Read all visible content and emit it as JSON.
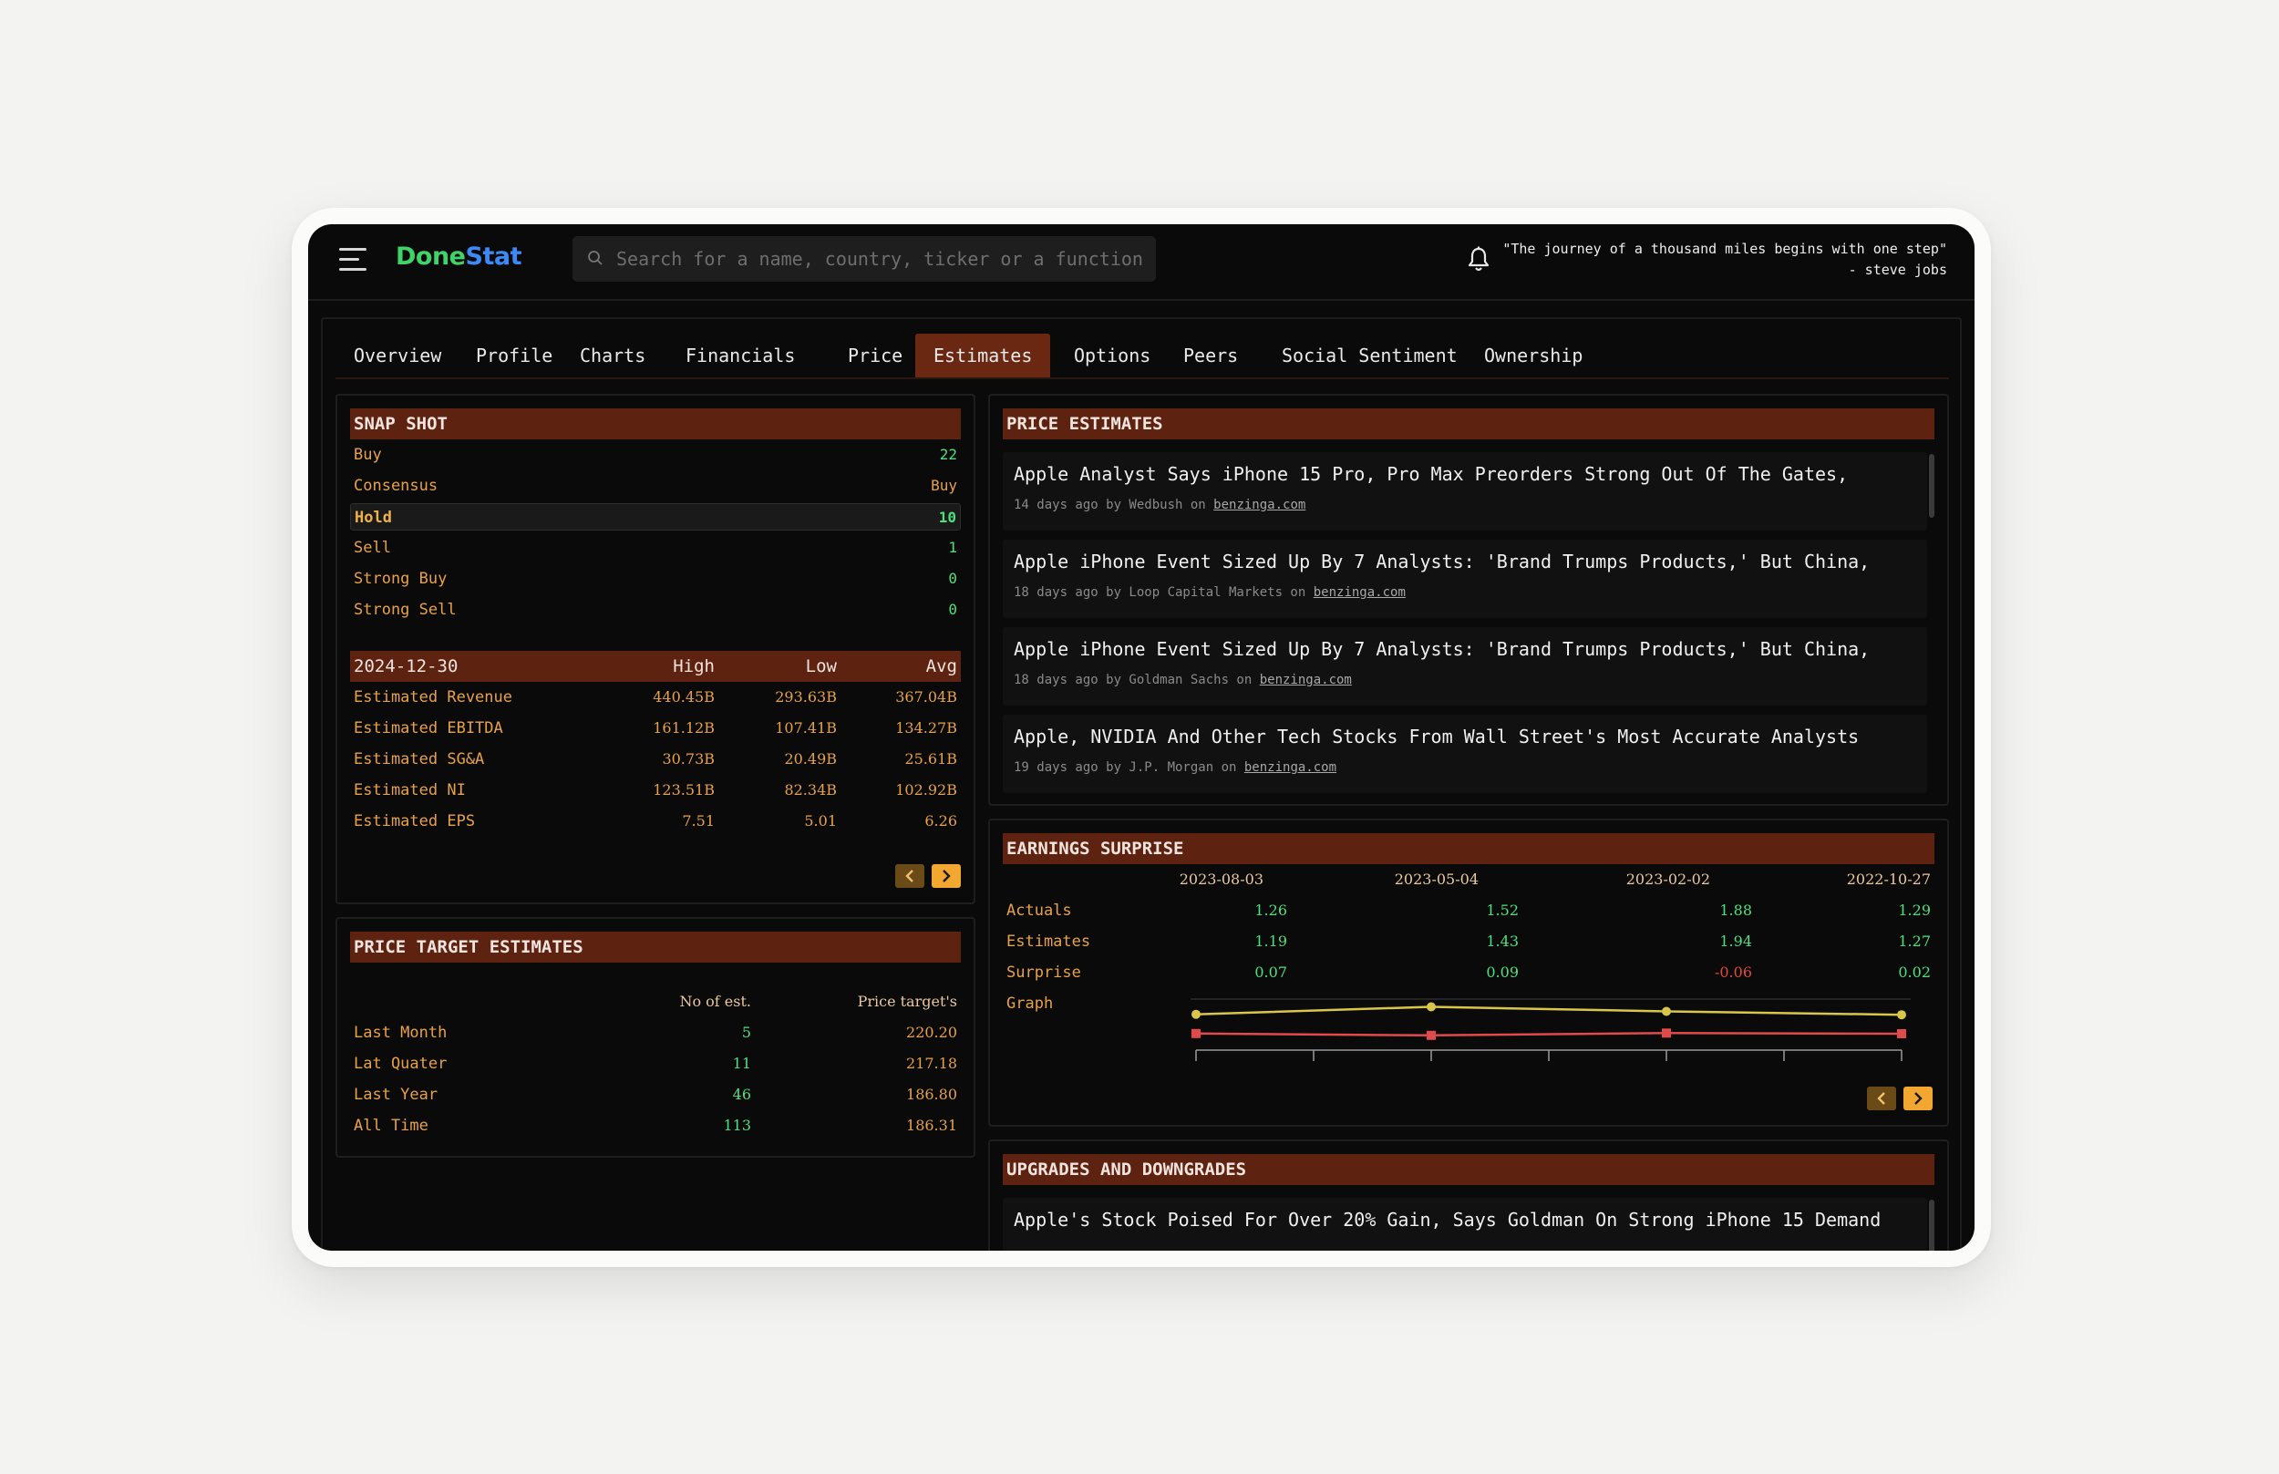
{
  "app": {
    "logo_part1": "Done",
    "logo_part2": "Stat"
  },
  "search": {
    "placeholder": "Search for a name, country, ticker or a function"
  },
  "quote": {
    "text": "\"The journey of a thousand miles begins with one step\"",
    "author": "- steve jobs"
  },
  "tabs": [
    "Overview",
    "Profile",
    "Charts",
    "Financials",
    "Price",
    "Estimates",
    "Options",
    "Peers",
    "Social Sentiment",
    "Ownership"
  ],
  "active_tab": "Estimates",
  "snapshot": {
    "title": "SNAP SHOT",
    "rows": [
      {
        "label": "Buy",
        "value": "22"
      },
      {
        "label": "Consensus",
        "value": "Buy"
      },
      {
        "label": "Hold",
        "value": "10"
      },
      {
        "label": "Sell",
        "value": "1"
      },
      {
        "label": "Strong Buy",
        "value": "0"
      },
      {
        "label": "Strong Sell",
        "value": "0"
      }
    ],
    "estimates_header": {
      "date": "2024-12-30",
      "high": "High",
      "low": "Low",
      "avg": "Avg"
    },
    "estimates": [
      {
        "label": "Estimated Revenue",
        "high": "440.45B",
        "low": "293.63B",
        "avg": "367.04B"
      },
      {
        "label": "Estimated EBITDA",
        "high": "161.12B",
        "low": "107.41B",
        "avg": "134.27B"
      },
      {
        "label": "Estimated SG&A",
        "high": "30.73B",
        "low": "20.49B",
        "avg": "25.61B"
      },
      {
        "label": "Estimated NI",
        "high": "123.51B",
        "low": "82.34B",
        "avg": "102.92B"
      },
      {
        "label": "Estimated EPS",
        "high": "7.51",
        "low": "5.01",
        "avg": "6.26"
      }
    ]
  },
  "price_target": {
    "title": "PRICE TARGET ESTIMATES",
    "col1": "No of est.",
    "col2": "Price target's",
    "rows": [
      {
        "label": "Last Month",
        "count": "5",
        "target": "220.20"
      },
      {
        "label": "Lat Quater",
        "count": "11",
        "target": "217.18"
      },
      {
        "label": "Last Year",
        "count": "46",
        "target": "186.80"
      },
      {
        "label": "All Time",
        "count": "113",
        "target": "186.31"
      }
    ]
  },
  "price_estimates": {
    "title": "PRICE ESTIMATES",
    "items": [
      {
        "title": "Apple Analyst Says iPhone 15 Pro, Pro Max Preorders Strong Out Of The Gates,",
        "meta": "14 days ago by Wedbush on ",
        "source": "benzinga.com"
      },
      {
        "title": "Apple iPhone Event Sized Up By 7 Analysts: 'Brand Trumps Products,' But China,",
        "meta": "18 days ago by Loop Capital Markets on ",
        "source": "benzinga.com"
      },
      {
        "title": "Apple iPhone Event Sized Up By 7 Analysts: 'Brand Trumps Products,' But China,",
        "meta": "18 days ago by Goldman Sachs on ",
        "source": "benzinga.com"
      },
      {
        "title": "Apple, NVIDIA And Other Tech Stocks From Wall Street's Most Accurate Analysts",
        "meta": "19 days ago by J.P. Morgan on ",
        "source": "benzinga.com"
      }
    ]
  },
  "earnings": {
    "title": "EARNINGS SURPRISE",
    "dates": [
      "2023-08-03",
      "2023-05-04",
      "2023-02-02",
      "2022-10-27"
    ],
    "rows": [
      {
        "label": "Actuals",
        "values": [
          "1.26",
          "1.52",
          "1.88",
          "1.29"
        ]
      },
      {
        "label": "Estimates",
        "values": [
          "1.19",
          "1.43",
          "1.94",
          "1.27"
        ]
      },
      {
        "label": "Surprise",
        "values": [
          "0.07",
          "0.09",
          "-0.06",
          "0.02"
        ]
      }
    ],
    "graph_label": "Graph",
    "colors": {
      "actual": "#d8c64a",
      "estimate": "#e04a4a"
    }
  },
  "upgrades": {
    "title": "UPGRADES AND DOWNGRADES",
    "items": [
      {
        "title": "Apple's Stock Poised For Over 20% Gain, Says Goldman On Strong iPhone 15 Demand"
      }
    ]
  }
}
